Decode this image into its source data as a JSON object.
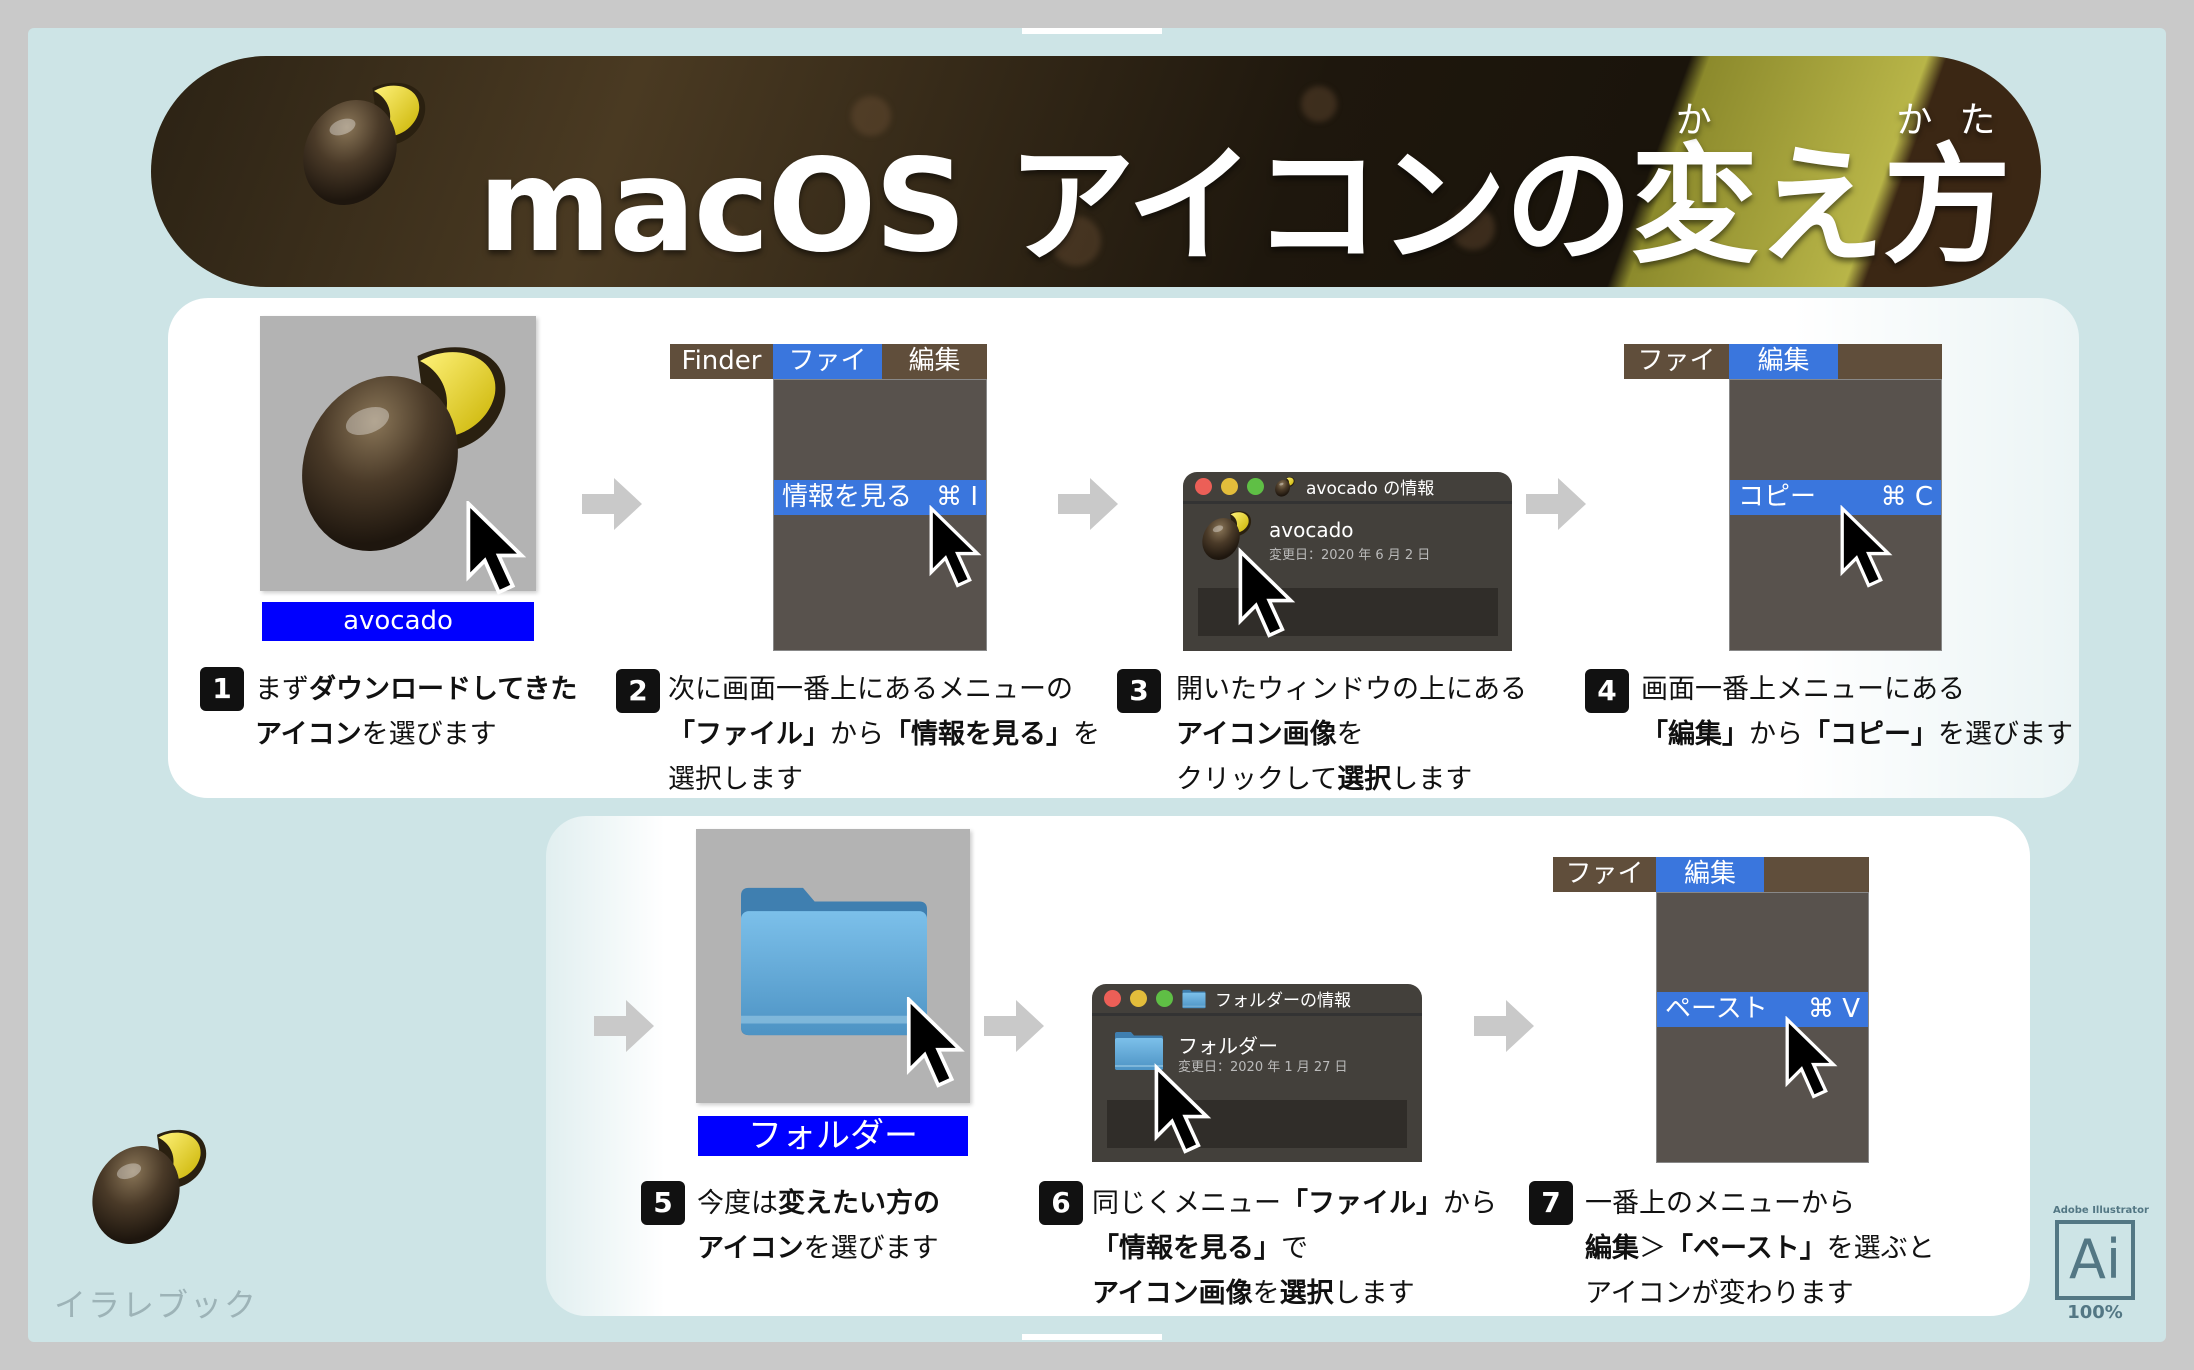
{
  "title": {
    "pre": "macOS アイコンの",
    "k1": "変",
    "r1": "か",
    "mid": "え",
    "k2": "方",
    "r2": "かた"
  },
  "colors": {
    "label_blue": "#0000ff",
    "menu_highlight": "#3a76dd",
    "menubar": "#604e3b",
    "background": "#cde4e6"
  },
  "step1": {
    "label": "avocado"
  },
  "step2": {
    "menubar": [
      "Finder",
      "ファイル",
      "編集"
    ],
    "item": "情報を見る",
    "shortcut": "⌘ I"
  },
  "step3": {
    "window_title": "avocado の情報",
    "name": "avocado",
    "date": "変更日：2020 年 6 月 2 日"
  },
  "step4": {
    "menubar": [
      "ファイル",
      "編集"
    ],
    "item": "コピー",
    "shortcut": "⌘ C"
  },
  "step5": {
    "label": "フォルダー"
  },
  "step6": {
    "window_title": "フォルダーの情報",
    "name": "フォルダー",
    "date": "変更日：2020 年 1 月 27 日"
  },
  "step7": {
    "menubar": [
      "ファイル",
      "編集"
    ],
    "item": "ペースト",
    "shortcut": "⌘ V"
  },
  "steps": [
    {
      "num": "1",
      "lines": [
        [
          {
            "t": "まず"
          },
          {
            "t": "ダウンロードしてきた",
            "b": true
          }
        ],
        [
          {
            "t": "アイコン",
            "b": true
          },
          {
            "t": "を選びます"
          }
        ]
      ]
    },
    {
      "num": "2",
      "lines": [
        [
          {
            "t": "次に画面一番上にあるメニューの"
          }
        ],
        [
          {
            "t": "「ファイル」",
            "b": true
          },
          {
            "t": "から"
          },
          {
            "t": "「情報を見る」",
            "b": true
          },
          {
            "t": "を"
          }
        ],
        [
          {
            "t": "選択します"
          }
        ]
      ]
    },
    {
      "num": "3",
      "lines": [
        [
          {
            "t": "開いたウィンドウの上にある"
          }
        ],
        [
          {
            "t": "アイコン画像",
            "b": true
          },
          {
            "t": "を"
          }
        ],
        [
          {
            "t": "クリックして"
          },
          {
            "t": "選択",
            "b": true
          },
          {
            "t": "します"
          }
        ]
      ]
    },
    {
      "num": "4",
      "lines": [
        [
          {
            "t": "画面一番上メニューにある"
          }
        ],
        [
          {
            "t": "「編集」",
            "b": true
          },
          {
            "t": "から"
          },
          {
            "t": "「コピー」",
            "b": true
          },
          {
            "t": "を選びます"
          }
        ]
      ]
    },
    {
      "num": "5",
      "lines": [
        [
          {
            "t": "今度は"
          },
          {
            "t": "変えたい方の",
            "b": true
          }
        ],
        [
          {
            "t": "アイコン",
            "b": true
          },
          {
            "t": "を選びます"
          }
        ]
      ]
    },
    {
      "num": "6",
      "lines": [
        [
          {
            "t": "同じくメニュー"
          },
          {
            "t": "「ファイル」",
            "b": true
          },
          {
            "t": "から"
          }
        ],
        [
          {
            "t": "「情報を見る」",
            "b": true
          },
          {
            "t": "で"
          }
        ],
        [
          {
            "t": "アイコン画像",
            "b": true
          },
          {
            "t": "を"
          },
          {
            "t": "選択",
            "b": true
          },
          {
            "t": "します"
          }
        ]
      ]
    },
    {
      "num": "7",
      "lines": [
        [
          {
            "t": "一番上のメニューから"
          }
        ],
        [
          {
            "t": "編集",
            "b": true
          },
          {
            "t": "＞"
          },
          {
            "t": "「ペースト」",
            "b": true
          },
          {
            "t": "を選ぶと"
          }
        ],
        [
          {
            "t": "アイコンが変わります"
          }
        ]
      ]
    }
  ],
  "brand": {
    "logo_text": "イラレブック"
  },
  "app_badge": {
    "app": "Adobe Illustrator",
    "glyph": "Ai",
    "zoom": "100%"
  }
}
